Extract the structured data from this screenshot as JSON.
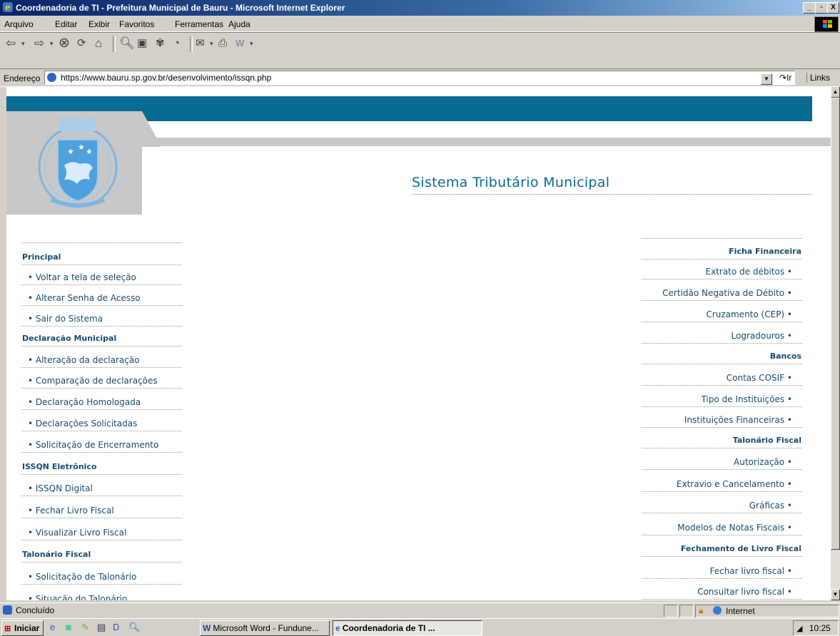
{
  "window": {
    "title": "Coordenadoria de TI - Prefeitura Municipal de Bauru - Microsoft Internet Explorer",
    "min_label": "_",
    "max_label": "▫",
    "close_label": "X"
  },
  "menu": {
    "items": [
      "Arquivo",
      "Editar",
      "Exibir",
      "Favoritos",
      "Ferramentas",
      "Ajuda"
    ]
  },
  "toolbar": {
    "icons": [
      "back-icon",
      "forward-icon",
      "stop-icon",
      "refresh-icon",
      "home-icon",
      "search-icon",
      "favorites-icon",
      "media-icon",
      "history-icon",
      "mail-icon",
      "print-icon",
      "edit-icon"
    ]
  },
  "address": {
    "label": "Endereço",
    "url": "https://www.bauru.sp.gov.br/desenvolvimento/issqn.php",
    "go_label": "Ir",
    "links_label": "Links"
  },
  "page": {
    "system_title": "Sistema Tributário Municipal",
    "left_menu": [
      {
        "label": "Principal",
        "heading": true
      },
      {
        "label": "• Voltar a tela de seleção",
        "heading": false
      },
      {
        "label": "• Alterar Senha de Acesso",
        "heading": false
      },
      {
        "label": "• Sair do Sistema",
        "heading": false
      },
      {
        "label": "Declaração Municipal",
        "heading": true
      },
      {
        "label": "• Alteração da declaração",
        "heading": false
      },
      {
        "label": "• Comparação de declarações",
        "heading": false
      },
      {
        "label": "• Declaração Homologada",
        "heading": false
      },
      {
        "label": "• Declarações Solicitadas",
        "heading": false
      },
      {
        "label": "• Solicitação de Encerramento",
        "heading": false
      },
      {
        "label": "ISSQN Eletrônico",
        "heading": true
      },
      {
        "label": "• ISSQN Digital",
        "heading": false
      },
      {
        "label": "• Fechar Livro Fiscal",
        "heading": false
      },
      {
        "label": "• Visualizar Livro Fiscal",
        "heading": false
      },
      {
        "label": "Talonário Fiscal",
        "heading": true
      },
      {
        "label": "• Solicitação de Talonário",
        "heading": false
      },
      {
        "label": "• Situação do Talonário",
        "heading": false
      }
    ],
    "right_menu": [
      {
        "label": "Ficha Financeira",
        "heading": true
      },
      {
        "label": "Extrato de débitos  •",
        "heading": false
      },
      {
        "label": "Certidão Negativa de Débito  •",
        "heading": false
      },
      {
        "label": "Cruzamento (CEP)  •",
        "heading": false
      },
      {
        "label": "Logradouros  •",
        "heading": false
      },
      {
        "label": "Bancos",
        "heading": true
      },
      {
        "label": "Contas COSIF  •",
        "heading": false
      },
      {
        "label": "Tipo de Instituições  •",
        "heading": false
      },
      {
        "label": "Instituições Financeiras  •",
        "heading": false
      },
      {
        "label": "Talonário Fiscal",
        "heading": true
      },
      {
        "label": "Autorização  •",
        "heading": false
      },
      {
        "label": "Extravio e Cancelamento  •",
        "heading": false
      },
      {
        "label": "Gráficas  •",
        "heading": false
      },
      {
        "label": "Modelos de Notas Fiscais  •",
        "heading": false
      },
      {
        "label": "Fechamento de Livro Fiscal",
        "heading": true
      },
      {
        "label": "Fechar livro fiscal  •",
        "heading": false
      },
      {
        "label": "Consultar livro fiscal  •",
        "heading": false
      }
    ]
  },
  "status": {
    "text": "Concluído",
    "zone": "Internet"
  },
  "taskbar": {
    "start_label": "Iniciar",
    "tasks": [
      "Microsoft Word - Fundune...",
      "Coordenadoria de TI ..."
    ],
    "clock": "10:25"
  },
  "colors": {
    "brand_blue": "#0a6b92",
    "menu_text": "#1a4b6e"
  }
}
